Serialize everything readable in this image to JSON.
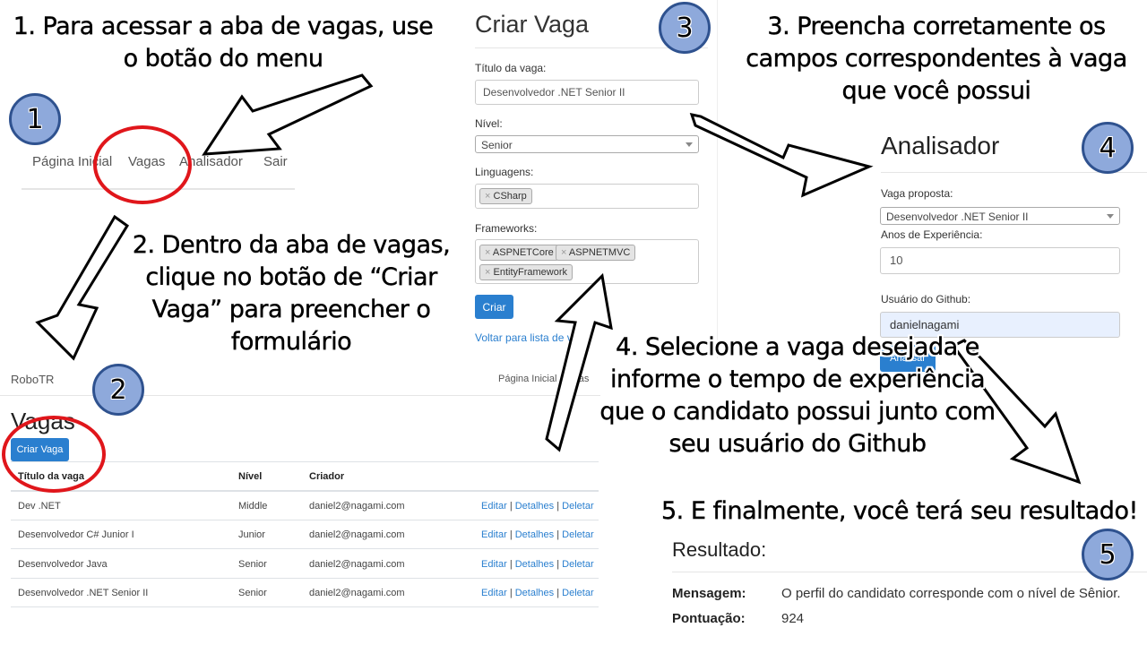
{
  "captions": {
    "step1": "1. Para acessar a aba de vagas, use o botão do menu",
    "step2": "2. Dentro da aba de vagas, clique no botão de “Criar Vaga” para preencher o formulário",
    "step3": "3. Preencha corretamente os campos correspondentes à vaga que você possui",
    "step4": "4. Selecione a vaga desejada e informe o tempo de experiência que o candidato possui junto com seu usuário do Github",
    "step5": "5. E finalmente, você terá seu resultado!"
  },
  "badges": {
    "b1": "1",
    "b2": "2",
    "b3": "3",
    "b4": "4",
    "b5": "5"
  },
  "nav_top": {
    "home": "Página Inicial",
    "vagas": "Vagas",
    "analisador": "Analisador",
    "sair": "Sair"
  },
  "vagas_page": {
    "brand": "RoboTR",
    "nav_home": "Página Inicial",
    "nav_vagas": "Vagas",
    "title": "Vagas",
    "create_button": "Criar Vaga",
    "columns": [
      "Título da vaga",
      "Nível",
      "Criador"
    ],
    "rows": [
      {
        "title": "Dev .NET",
        "level": "Middle",
        "creator": "daniel2@nagami.com"
      },
      {
        "title": "Desenvolvedor C# Junior I",
        "level": "Junior",
        "creator": "daniel2@nagami.com"
      },
      {
        "title": "Desenvolvedor Java",
        "level": "Senior",
        "creator": "daniel2@nagami.com"
      },
      {
        "title": "Desenvolvedor .NET Senior II",
        "level": "Senior",
        "creator": "daniel2@nagami.com"
      }
    ],
    "actions": {
      "edit": "Editar",
      "details": "Detalhes",
      "delete": "Deletar",
      "sep": "|"
    }
  },
  "criar_vaga": {
    "title": "Criar Vaga",
    "titulo_label": "Título da vaga:",
    "titulo_value": "Desenvolvedor .NET Senior II",
    "nivel_label": "Nível:",
    "nivel_value": "Senior",
    "linguagens_label": "Linguagens:",
    "linguagens": [
      "CSharp"
    ],
    "frameworks_label": "Frameworks:",
    "frameworks": [
      "ASPNETCore",
      "ASPNETMVC",
      "EntityFramework"
    ],
    "tag_remove": "×",
    "submit": "Criar",
    "back_link": "Voltar para lista de vagas"
  },
  "analisador": {
    "title": "Analisador",
    "vaga_label": "Vaga proposta:",
    "vaga_value": "Desenvolvedor .NET Senior II",
    "anos_label": "Anos de Experiência:",
    "anos_value": "10",
    "github_label": "Usuário do Github:",
    "github_value": "danielnagami",
    "submit": "Analisar"
  },
  "resultado": {
    "title": "Resultado:",
    "mensagem_label": "Mensagem:",
    "mensagem_value": "O perfil do candidato corresponde com o nível de Sênior.",
    "pontuacao_label": "Pontuação:",
    "pontuacao_value": "924"
  },
  "colors": {
    "primary": "#2a7fcf",
    "badge_fill": "#8ea9db",
    "badge_border": "#2f528f",
    "highlight": "#e0161b",
    "input_active": "#e8f0fe"
  }
}
